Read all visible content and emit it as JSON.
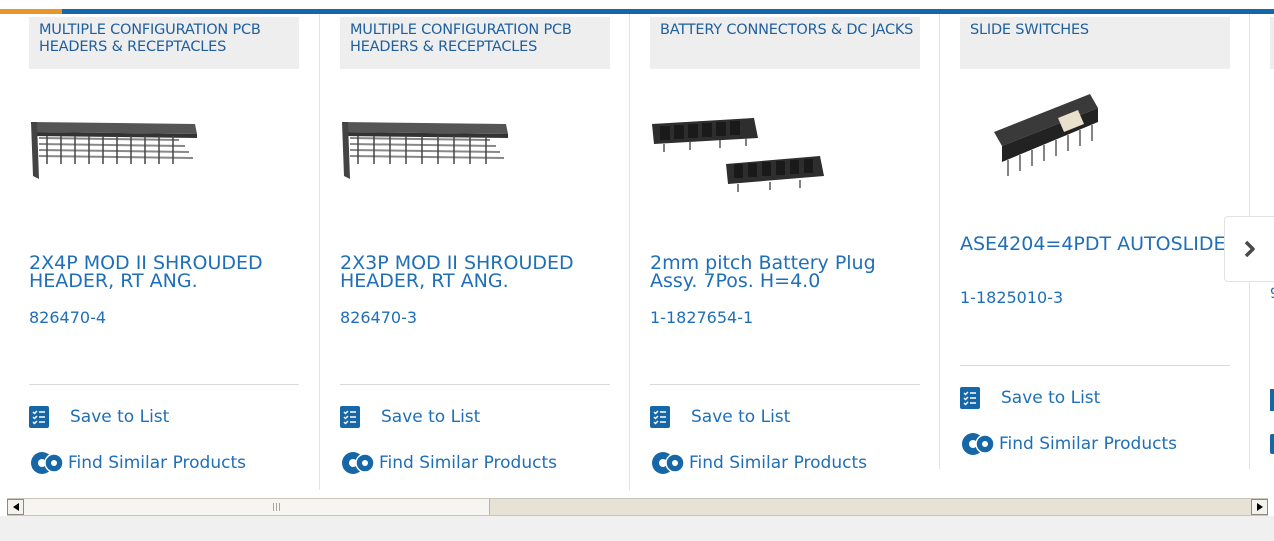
{
  "products": [
    {
      "category": "MULTIPLE CONFIGURATION PCB HEADERS & RECEPTACLES",
      "title": "2X4P MOD II SHROUDED HEADER, RT ANG.",
      "part_number": "826470-4",
      "save_label": "Save to List",
      "similar_label": "Find Similar Products"
    },
    {
      "category": "MULTIPLE CONFIGURATION PCB HEADERS & RECEPTACLES",
      "title": "2X3P MOD II SHROUDED HEADER, RT ANG.",
      "part_number": "826470-3",
      "save_label": "Save to List",
      "similar_label": "Find Similar Products"
    },
    {
      "category": "BATTERY CONNECTORS & DC JACKS",
      "title": "2mm pitch Battery Plug Assy. 7Pos. H=4.0",
      "part_number": "1-1827654-1",
      "save_label": "Save to List",
      "similar_label": "Find Similar Products"
    },
    {
      "category": "SLIDE SWITCHES",
      "title": "ASE4204=4PDT AUTOSLIDE",
      "part_number": "1-1825010-3",
      "save_label": "Save to List",
      "similar_label": "Find Similar Products"
    }
  ],
  "carousel": {
    "next_icon": "chevron-right-icon",
    "peek_text": "9"
  },
  "colors": {
    "brand_blue": "#1567a8",
    "link_blue": "#1f6fb8",
    "accent_orange": "#e8962b",
    "category_bg": "#eeeeee"
  }
}
